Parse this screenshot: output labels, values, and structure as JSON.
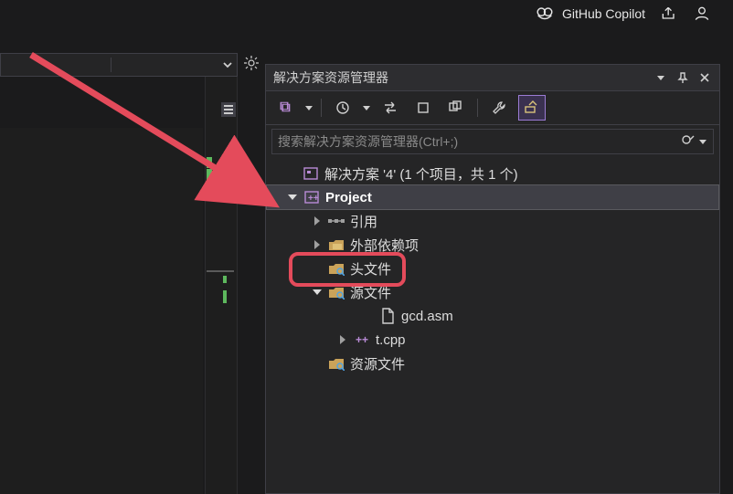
{
  "topbar": {
    "copilot_label": "GitHub Copilot"
  },
  "panel": {
    "title": "解决方案资源管理器"
  },
  "search": {
    "placeholder": "搜索解决方案资源管理器(Ctrl+;)"
  },
  "tree": {
    "solution_label": "解决方案 '4' (1 个项目，共 1 个)",
    "project_label": "Project",
    "references_label": "引用",
    "external_deps_label": "外部依赖项",
    "headers_label": "头文件",
    "sources_label": "源文件",
    "gcd_label": "gcd.asm",
    "tcpp_label": "t.cpp",
    "resources_label": "资源文件"
  }
}
